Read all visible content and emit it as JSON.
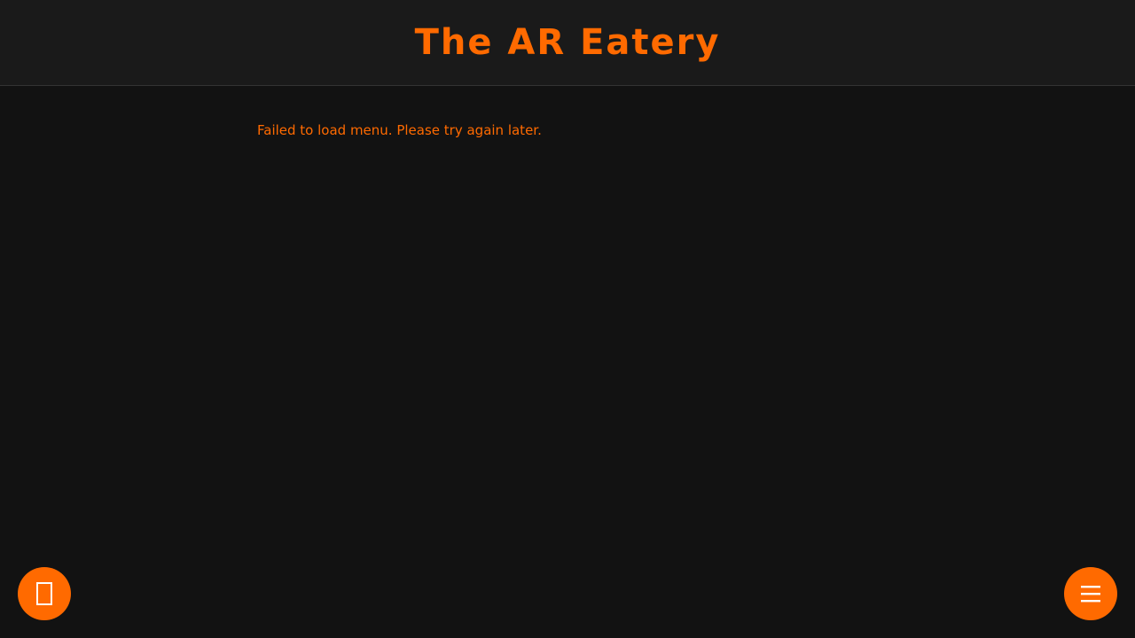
{
  "header": {
    "title": "The AR Eatery"
  },
  "main": {
    "error_message": "Failed to load menu. Please try again later."
  },
  "fab_left": {
    "icon": "missing-glyph-icon"
  },
  "fab_right": {
    "icon": "menu-icon"
  },
  "colors": {
    "accent": "#ff6a00",
    "background": "#121212",
    "header_background": "#1a1a1a",
    "icon": "#ffffff"
  }
}
